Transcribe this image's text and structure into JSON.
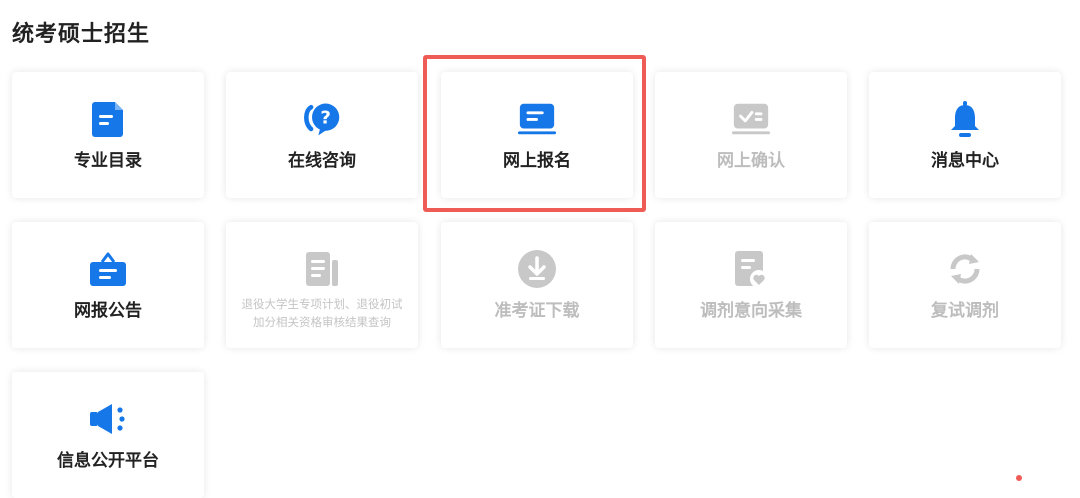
{
  "page": {
    "title": "统考硕士招生"
  },
  "colors": {
    "accent": "#1677e8",
    "disabled": "#c8c8c8",
    "highlight": "#ef5b55"
  },
  "tiles": [
    {
      "label": "专业目录",
      "icon": "document-icon",
      "enabled": true
    },
    {
      "label": "在线咨询",
      "icon": "chat-question-icon",
      "enabled": true
    },
    {
      "label": "网上报名",
      "icon": "laptop-form-icon",
      "enabled": true,
      "highlighted": true
    },
    {
      "label": "网上确认",
      "icon": "monitor-check-icon",
      "enabled": false
    },
    {
      "label": "消息中心",
      "icon": "bell-icon",
      "enabled": true
    },
    {
      "label": "网报公告",
      "icon": "notice-bag-icon",
      "enabled": true
    },
    {
      "label_line1": "退役大学生专项计划、退役初试",
      "label_line2": "加分相关资格审核结果查询",
      "icon": "list-doc-icon",
      "enabled": false
    },
    {
      "label": "准考证下载",
      "icon": "download-icon",
      "enabled": false
    },
    {
      "label": "调剂意向采集",
      "icon": "doc-heart-icon",
      "enabled": false
    },
    {
      "label": "复试调剂",
      "icon": "refresh-icon",
      "enabled": false
    },
    {
      "label": "信息公开平台",
      "icon": "megaphone-icon",
      "enabled": true
    }
  ]
}
